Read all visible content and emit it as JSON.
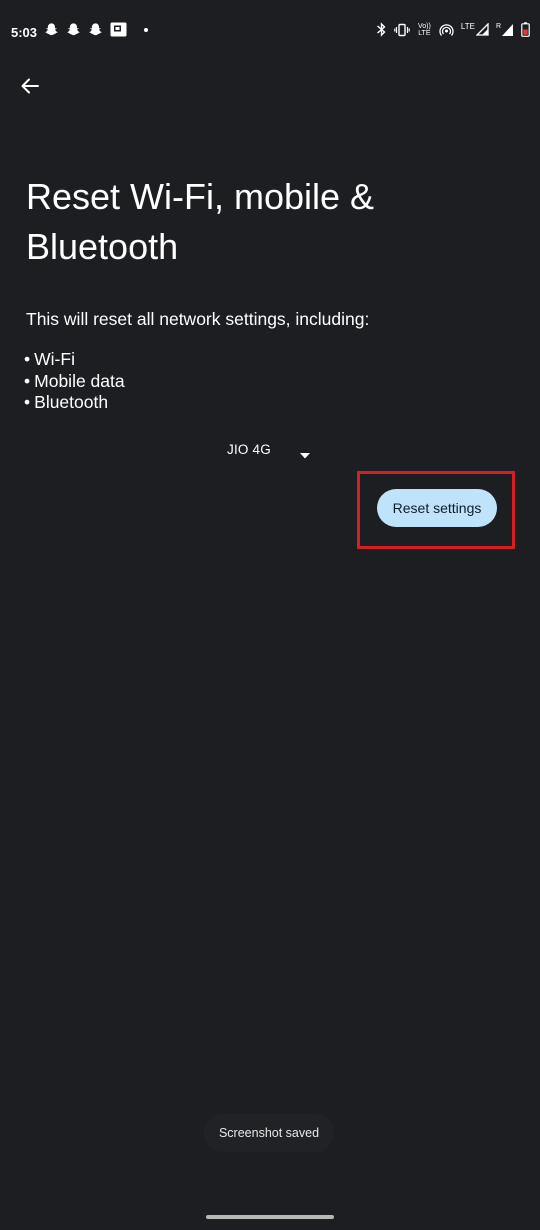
{
  "status_bar": {
    "time": "5:03",
    "left_icons": [
      "snapchat-icon",
      "snapchat-icon",
      "snapchat-icon",
      "media-icon"
    ],
    "right_icons": [
      "bluetooth-icon",
      "vibrate-icon",
      "volte-icon",
      "hotspot-icon",
      "lte-signal-icon",
      "signal-icon",
      "battery-icon"
    ],
    "volte_top": "Vo))",
    "volte_bottom": "LTE",
    "lte_label": "LTE",
    "roaming_label": "R"
  },
  "header": {
    "back_icon": "arrow-back-icon"
  },
  "main": {
    "title": "Reset Wi-Fi, mobile & Bluetooth",
    "intro": "This will reset all network settings, including:",
    "bullets": [
      "Wi-Fi",
      "Mobile data",
      "Bluetooth"
    ],
    "bullet_symbol": "•",
    "sim_selected": "JIO 4G",
    "reset_button_label": "Reset settings"
  },
  "toast": {
    "message": "Screenshot saved"
  },
  "colors": {
    "background": "#1c1e22",
    "button_bg": "#bfe3fb",
    "highlight": "#d41f26"
  }
}
